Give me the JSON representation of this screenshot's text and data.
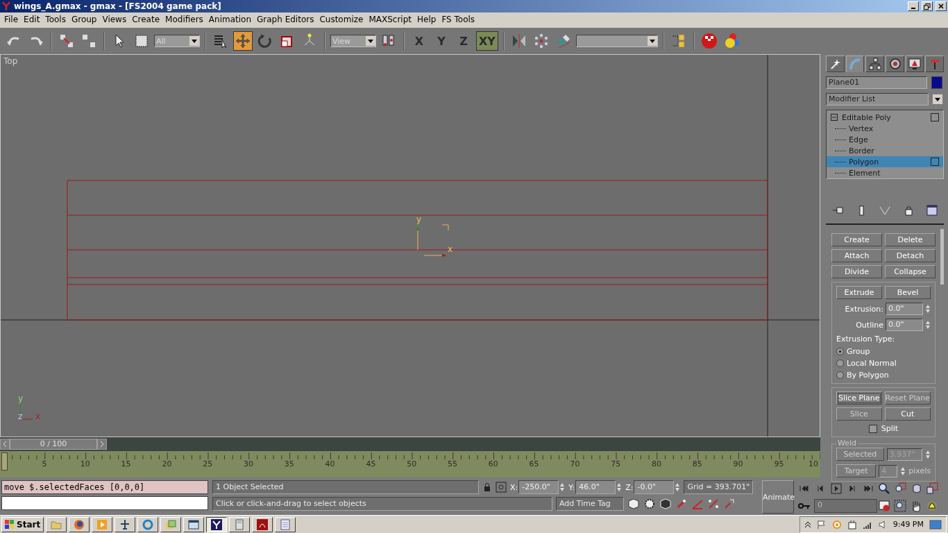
{
  "window": {
    "title": "wings_A.gmax - gmax - [FS2004 game pack]"
  },
  "menu": [
    "File",
    "Edit",
    "Tools",
    "Group",
    "Views",
    "Create",
    "Modifiers",
    "Animation",
    "Graph Editors",
    "Customize",
    "MAXScript",
    "Help",
    "FS Tools"
  ],
  "toolbar": {
    "selection_filter": "All",
    "coordinate_system": "View",
    "transform_tools": [
      {
        "kind": "move",
        "selected": true
      },
      {
        "kind": "rotate",
        "selected": false
      },
      {
        "kind": "scale",
        "selected": false
      }
    ],
    "axis_constraints": [
      {
        "label": "X",
        "selected": false
      },
      {
        "label": "Y",
        "selected": false
      },
      {
        "label": "Z",
        "selected": false
      },
      {
        "label": "XY",
        "selected": true
      }
    ]
  },
  "viewport": {
    "label": "Top",
    "gizmo_labels": [
      "y",
      "x"
    ],
    "corner_axes": [
      "y",
      "z",
      "x"
    ]
  },
  "command_panel": {
    "tabs": [
      {
        "kind": "create",
        "selected": false
      },
      {
        "kind": "modify",
        "selected": true
      },
      {
        "kind": "hierarchy",
        "selected": false
      },
      {
        "kind": "motion",
        "selected": false
      },
      {
        "kind": "display",
        "selected": false
      },
      {
        "kind": "utilities",
        "selected": false
      }
    ],
    "object_name": "Plane01",
    "modifier_list": "Modifier List",
    "stack": {
      "label": "Editable Poly",
      "children": [
        {
          "label": "Vertex",
          "selected": false
        },
        {
          "label": "Edge",
          "selected": false
        },
        {
          "label": "Border",
          "selected": false
        },
        {
          "label": "Polygon",
          "selected": true
        },
        {
          "label": "Element",
          "selected": false
        }
      ]
    },
    "top_buttons": [
      {
        "label": "Create",
        "disabled": false
      },
      {
        "label": "Delete",
        "disabled": false
      },
      {
        "label": "Attach",
        "disabled": false
      },
      {
        "label": "Detach",
        "disabled": false
      },
      {
        "label": "Divide",
        "disabled": false
      },
      {
        "label": "Collapse",
        "disabled": false
      }
    ],
    "extrude_group": {
      "buttons": [
        {
          "label": "Extrude",
          "disabled": false
        },
        {
          "label": "Bevel",
          "disabled": false
        }
      ],
      "spinners": [
        {
          "label": "Extrusion:",
          "value": "0.0\""
        },
        {
          "label": "Outline",
          "value": "0.0\""
        }
      ],
      "type_label": "Extrusion Type:",
      "options": [
        {
          "label": "Group",
          "selected": true
        },
        {
          "label": "Local Normal",
          "selected": false
        },
        {
          "label": "By Polygon",
          "selected": false
        }
      ]
    },
    "slice_group": {
      "buttons": [
        {
          "label": "Slice Plane",
          "disabled": false,
          "focused": true
        },
        {
          "label": "Reset Plane",
          "disabled": true,
          "focused": false
        },
        {
          "label": "Slice",
          "disabled": true,
          "focused": false
        },
        {
          "label": "Cut",
          "disabled": false,
          "focused": false
        }
      ],
      "split": {
        "label": "Split",
        "checked": false
      }
    },
    "weld_group": {
      "title": "Weld",
      "disabled": true,
      "rows": [
        {
          "button": "Selected",
          "value": "3.937\""
        },
        {
          "button": "Target",
          "value": "4",
          "unit": "pixels"
        }
      ]
    }
  },
  "time_slider": {
    "label": "0 / 100",
    "level": 0
  },
  "track_bar": {
    "ticks": [
      "5",
      "10",
      "15",
      "20",
      "25",
      "30",
      "35",
      "40",
      "45",
      "50",
      "55",
      "60",
      "65",
      "70",
      "75",
      "80",
      "85",
      "90",
      "95",
      "10"
    ]
  },
  "status": {
    "script_line": "move $.selectedFaces [0,0,0]",
    "selection": "1 Object Selected",
    "prompt": "Click or click-and-drag to select objects",
    "coords": [
      {
        "axis": "X:",
        "value": "-250.0\""
      },
      {
        "axis": "Y:",
        "value": "46.0\""
      },
      {
        "axis": "Z:",
        "value": "-0.0\""
      }
    ],
    "grid": "Grid = 393.701\"",
    "time_tag": "Add Time Tag",
    "animate": "Animate",
    "frame": "0"
  },
  "taskbar": {
    "start": "Start",
    "items": [
      {
        "kind": "gmax",
        "selected": true
      },
      {
        "kind": "calculator",
        "selected": false
      },
      {
        "kind": "pdf",
        "selected": false
      },
      {
        "kind": "notepad",
        "selected": false
      }
    ],
    "clock": "9:49 PM"
  }
}
